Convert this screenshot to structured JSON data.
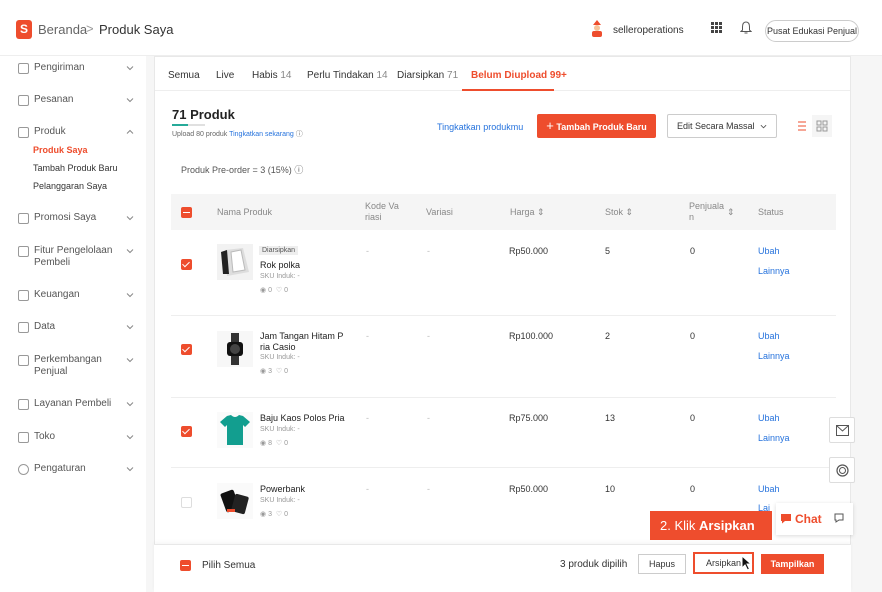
{
  "header": {
    "breadcrumb_home": "Beranda",
    "breadcrumb_sep": ">",
    "breadcrumb_current": "Produk Saya",
    "logo_letter": "S",
    "seller_name": "selleroperations",
    "edu_button": "Pusat Edukasi Penjual"
  },
  "sidebar": {
    "items": [
      {
        "label": "Pengiriman"
      },
      {
        "label": "Pesanan"
      },
      {
        "label": "Produk"
      },
      {
        "label": "Promosi Saya"
      },
      {
        "label": "Fitur Pengelolaan Pembeli"
      },
      {
        "label": "Keuangan"
      },
      {
        "label": "Data"
      },
      {
        "label": "Perkembangan Penjual"
      },
      {
        "label": "Layanan Pembeli"
      },
      {
        "label": "Toko"
      },
      {
        "label": "Pengaturan"
      }
    ],
    "sub_items": [
      {
        "label": "Produk Saya"
      },
      {
        "label": "Tambah Produk Baru"
      },
      {
        "label": "Pelanggaran Saya"
      }
    ]
  },
  "tabs": [
    {
      "label": "Semua",
      "count": ""
    },
    {
      "label": "Live",
      "count": ""
    },
    {
      "label": "Habis",
      "count": "14"
    },
    {
      "label": "Perlu Tindakan",
      "count": "14"
    },
    {
      "label": "Diarsipkan",
      "count": "71"
    },
    {
      "label": "Belum Diupload",
      "count": "99+"
    }
  ],
  "summary": {
    "product_count": "71 Produk",
    "upload_progress": 0.47,
    "upload_note": "Upload 80 produk",
    "upload_link": "Tingkatkan sekarang",
    "upgrade_link": "Tingkatkan produkmu",
    "add_button": "Tambah Produk Baru",
    "mass_edit": "Edit Secara Massal",
    "preorder": "Produk Pre-order = 3 (15%)"
  },
  "table": {
    "headers": {
      "name": "Nama Produk",
      "code": "Kode Va riasi",
      "variation": "Variasi",
      "price": "Harga",
      "stock": "Stok",
      "sales": "Penjuala n",
      "status": "Status"
    },
    "rows": [
      {
        "tag": "Diarsipkan",
        "name": "Rok polka",
        "sku": "SKU Induk: -",
        "views": "0",
        "likes": "0",
        "code": "-",
        "variation": "-",
        "price": "Rp50.000",
        "stock": "5",
        "sales": "0",
        "action1": "Ubah",
        "action2": "Lainnya"
      },
      {
        "tag": "",
        "name": "Jam Tangan Hitam P ria Casio",
        "sku": "SKU Induk: -",
        "views": "3",
        "likes": "0",
        "code": "-",
        "variation": "-",
        "price": "Rp100.000",
        "stock": "2",
        "sales": "0",
        "action1": "Ubah",
        "action2": "Lainnya"
      },
      {
        "tag": "",
        "name": "Baju Kaos Polos Pria",
        "sku": "SKU Induk: -",
        "views": "8",
        "likes": "0",
        "code": "-",
        "variation": "-",
        "price": "Rp75.000",
        "stock": "13",
        "sales": "0",
        "action1": "Ubah",
        "action2": "Lainnya"
      },
      {
        "tag": "",
        "name": "Powerbank",
        "sku": "SKU Induk: -",
        "views": "3",
        "likes": "0",
        "code": "-",
        "variation": "-",
        "price": "Rp50.000",
        "stock": "10",
        "sales": "0",
        "action1": "Ubah",
        "action2": "Lai"
      }
    ]
  },
  "bottom": {
    "select_all": "Pilih Semua",
    "selected": "3 produk dipilih",
    "delete": "Hapus",
    "archive": "Arsipkan",
    "show": "Tampilkan"
  },
  "callout": {
    "prefix": "2. Klik",
    "action": "Arsipkan"
  },
  "chat": {
    "label": "Chat"
  },
  "colors": {
    "accent": "#ee4d2d",
    "link": "#2673dd",
    "progress": "#26aa99"
  }
}
